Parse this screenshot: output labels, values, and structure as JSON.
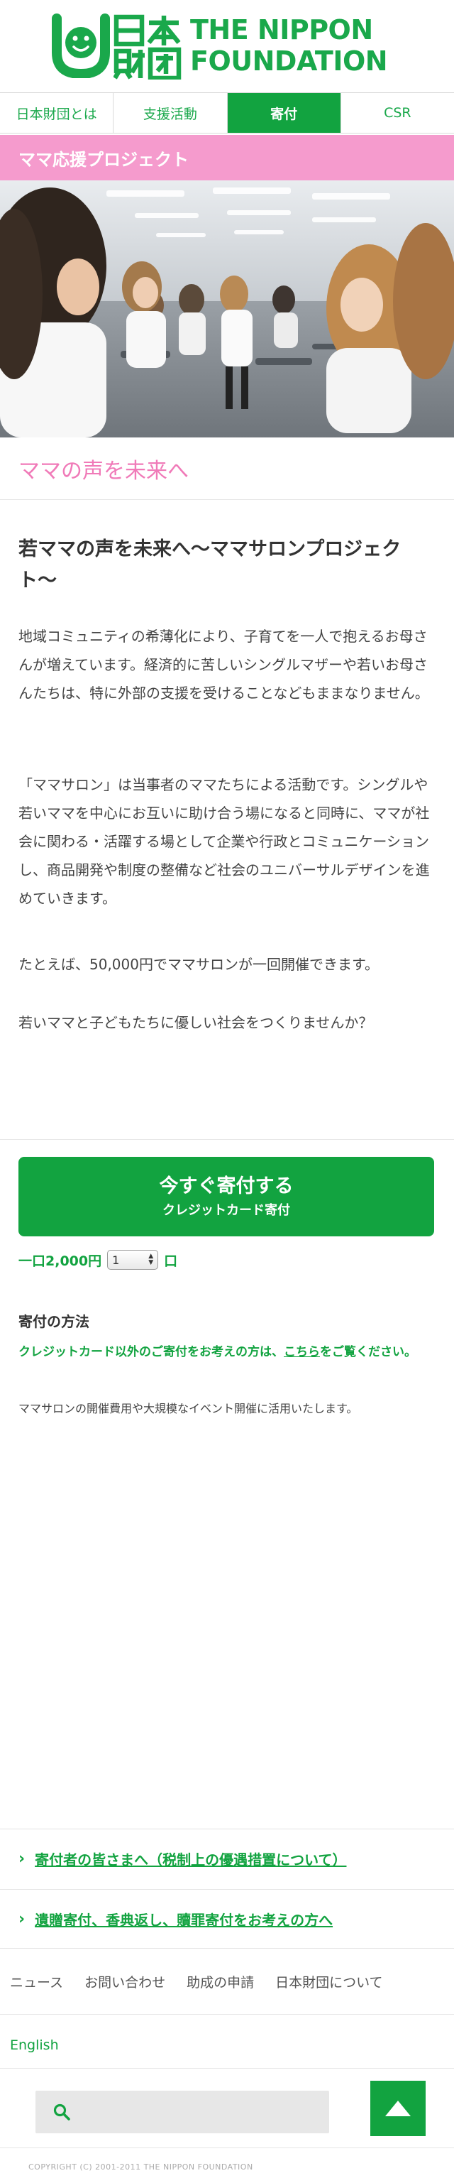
{
  "header": {
    "logo_en_line1": "THE NIPPON",
    "logo_en_line2": "FOUNDATION"
  },
  "nav": {
    "items": [
      {
        "label": "日本財団とは"
      },
      {
        "label": "支援活動"
      },
      {
        "label": "寄付",
        "active": true
      },
      {
        "label": "CSR"
      }
    ]
  },
  "section_bar": {
    "title": "ママ応援プロジェクト"
  },
  "sub_title": "ママの声を未来へ",
  "article": {
    "heading": "若ママの声を未来へ〜ママサロンプロジェクト〜",
    "paragraphs": [
      "地域コミュニティの希薄化により、子育てを一人で抱えるお母さんが増えています。経済的に苦しいシングルマザーや若いお母さんたちは、特に外部の支援を受けることなどもままなりません。",
      "「ママサロン」は当事者のママたちによる活動です。シングルや若いママを中心にお互いに助け合う場になると同時に、ママが社会に関わる・活躍する場として企業や行政とコミュニケーションし、商品開発や制度の整備など社会のユニバーサルデザインを進めていきます。",
      "たとえば、50,000円でママサロンが一回開催できます。",
      "若いママと子どもたちに優しい社会をつくりませんか？"
    ]
  },
  "donate": {
    "button_main": "今すぐ寄付する",
    "button_sub": "クレジットカード寄付",
    "unit_prefix": "一口2,000円",
    "quantity": "1",
    "unit_suffix": "口"
  },
  "method": {
    "title": "寄付の方法",
    "note_before": "クレジットカード以外のご寄付をお考えの方は、",
    "note_link": "こちら",
    "note_after": "をご覧ください。",
    "description": "ママサロンの開催費用や大規模なイベント開催に活用いたします。"
  },
  "links": [
    {
      "label": "寄付者の皆さまへ（税制上の優遇措置について）"
    },
    {
      "label": "遺贈寄付、香典返し、贖罪寄付をお考えの方へ"
    }
  ],
  "footer": {
    "nav": [
      "ニュース",
      "お問い合わせ",
      "助成の申請",
      "日本財団について"
    ],
    "english": "English",
    "copyright": "COPYRIGHT (C) 2001-2011 THE NIPPON FOUNDATION"
  },
  "colors": {
    "brand_green": "#12a340",
    "pink": "#f59bcd",
    "pink_text": "#f07ab8"
  }
}
